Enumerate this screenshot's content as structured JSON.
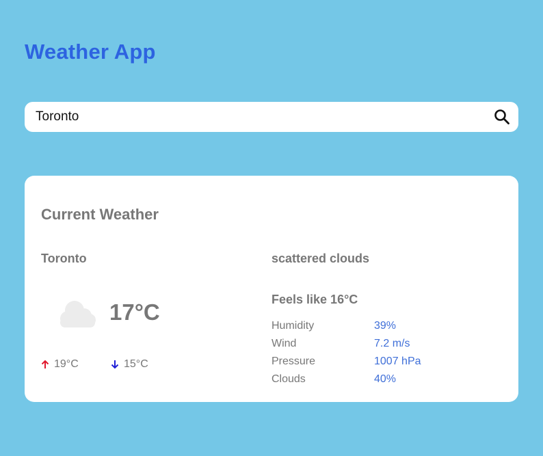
{
  "app": {
    "title": "Weather App"
  },
  "search": {
    "value": "Toronto",
    "button_icon": "search-icon"
  },
  "weather": {
    "section_title": "Current Weather",
    "city": "Toronto",
    "description": "scattered clouds",
    "icon": "cloud-icon",
    "temperature": "17°C",
    "feels_like": "Feels like 16°C",
    "temp_max": "19°C",
    "temp_min": "15°C",
    "details": [
      {
        "label": "Humidity",
        "value": "39%"
      },
      {
        "label": "Wind",
        "value": "7.2 m/s"
      },
      {
        "label": "Pressure",
        "value": "1007 hPa"
      },
      {
        "label": "Clouds",
        "value": "40%"
      }
    ]
  },
  "colors": {
    "background": "#74c7e7",
    "title": "#2d63e0",
    "detail_value": "#3f6fd8",
    "arrow_up": "#e0182d",
    "arrow_down": "#1f1fd6",
    "muted_text": "#777777"
  }
}
